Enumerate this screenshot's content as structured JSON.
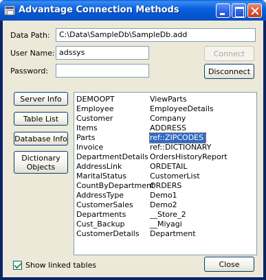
{
  "window": {
    "title": "Advantage Connection Methods"
  },
  "form": {
    "data_path_label": "Data Path:",
    "data_path_value": "C:\\Data\\SampleDb\\SampleDb.add",
    "user_name_label": "User Name:",
    "user_name_value": "adssys",
    "password_label": "Password:",
    "password_value": ""
  },
  "buttons": {
    "connect": "Connect",
    "disconnect": "Disconnect",
    "server_info": "Server Info",
    "table_list": "Table List",
    "database_info": "Database Info",
    "dictionary_objects": "Dictionary Objects",
    "close": "Close"
  },
  "list": {
    "column1": [
      "DEMOOPT",
      "Employee",
      "Customer",
      "Items",
      "Parts",
      "Invoice",
      "DepartmentDetails",
      "AddressLink",
      "MaritalStatus",
      "CountByDepartment",
      "AddressType",
      "CustomerSales",
      "Departments",
      "Cust_Backup",
      "CustomerDetails"
    ],
    "column2": [
      "ViewParts",
      "EmployeeDetails",
      "Company",
      "ADDRESS",
      "ref::ZIPCODES",
      "ref::DICTIONARY",
      "OrdersHistoryReport",
      "ORDETAIL",
      "CustomerList",
      "ORDERS",
      "Demo1",
      "Demo2",
      "__Store_2",
      "__Miyagi",
      "Department"
    ],
    "selected_value": "ref::ZIPCODES"
  },
  "options": {
    "show_linked_tables_label": "Show linked tables",
    "show_linked_tables_checked": true
  },
  "icons": {
    "app": "database-window-icon",
    "minimize": "minimize-icon",
    "maximize": "maximize-icon",
    "close": "close-icon"
  }
}
